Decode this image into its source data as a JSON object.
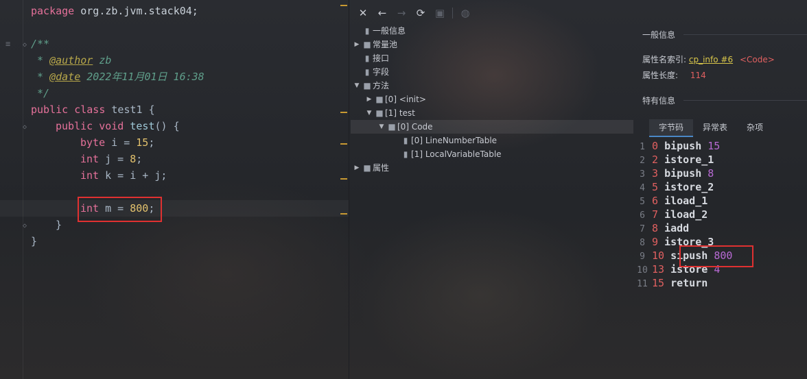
{
  "editor": {
    "lines": {
      "package_kw": "package",
      "package_name": "org.zb.jvm.stack04;",
      "doc_open": "/**",
      "author_prefix": " * ",
      "author_tag": "@author",
      "author_value": " zb",
      "date_prefix": " * ",
      "date_tag": "@date",
      "date_value": " 2022年11月01日 16:38",
      "doc_close": " */",
      "class_kw": "public class",
      "class_name": " test1 {",
      "method_kw": "public void",
      "method_name": " test",
      "method_tail": "() {",
      "l1_type": "byte",
      "l1_rest": " i = ",
      "l1_num": "15",
      "l1_end": ";",
      "l2_type": "int",
      "l2_rest": " j = ",
      "l2_num": "8",
      "l2_end": ";",
      "l3_type": "int",
      "l3_rest": " k = i + j;",
      "l4_type": "int",
      "l4_rest": " m = ",
      "l4_num": "800",
      "l4_end": ";",
      "close_method": "}",
      "close_class": "}"
    }
  },
  "tree": {
    "toolbar": {
      "close": "✕",
      "back": "←",
      "forward": "→",
      "refresh": "⟳",
      "save": "▣",
      "web": "◍"
    },
    "items": [
      {
        "label": "一般信息"
      },
      {
        "label": "常量池"
      },
      {
        "label": "接口"
      },
      {
        "label": "字段"
      },
      {
        "label": "方法"
      },
      {
        "label": "[0] <init>"
      },
      {
        "label": "[1] test"
      },
      {
        "label": "[0] Code"
      },
      {
        "label": "[0] LineNumberTable"
      },
      {
        "label": "[1] LocalVariableTable"
      },
      {
        "label": "属性"
      }
    ]
  },
  "info": {
    "general_title": "一般信息",
    "name_index_label": "属性名索引:",
    "name_index_link": "cp_info #6",
    "name_index_value": "<Code>",
    "length_label": "属性长度:",
    "length_value": "114",
    "specific_title": "特有信息",
    "tabs": [
      "字节码",
      "异常表",
      "杂项"
    ],
    "bytecode": [
      {
        "line": "1",
        "offset": "0",
        "op": "bipush",
        "arg": "15"
      },
      {
        "line": "2",
        "offset": "2",
        "op": "istore_1",
        "arg": ""
      },
      {
        "line": "3",
        "offset": "3",
        "op": "bipush",
        "arg": "8"
      },
      {
        "line": "4",
        "offset": "5",
        "op": "istore_2",
        "arg": ""
      },
      {
        "line": "5",
        "offset": "6",
        "op": "iload_1",
        "arg": ""
      },
      {
        "line": "6",
        "offset": "7",
        "op": "iload_2",
        "arg": ""
      },
      {
        "line": "7",
        "offset": "8",
        "op": "iadd",
        "arg": ""
      },
      {
        "line": "8",
        "offset": "9",
        "op": "istore_3",
        "arg": ""
      },
      {
        "line": "9",
        "offset": "10",
        "op": "sipush",
        "arg": "800"
      },
      {
        "line": "10",
        "offset": "13",
        "op": "istore",
        "arg": "4"
      },
      {
        "line": "11",
        "offset": "15",
        "op": "return",
        "arg": ""
      }
    ]
  },
  "colors": {
    "highlight_box": "#e03131",
    "keyword": "#e5719a",
    "number": "#e3c26d",
    "comment": "#5f9e8a"
  }
}
